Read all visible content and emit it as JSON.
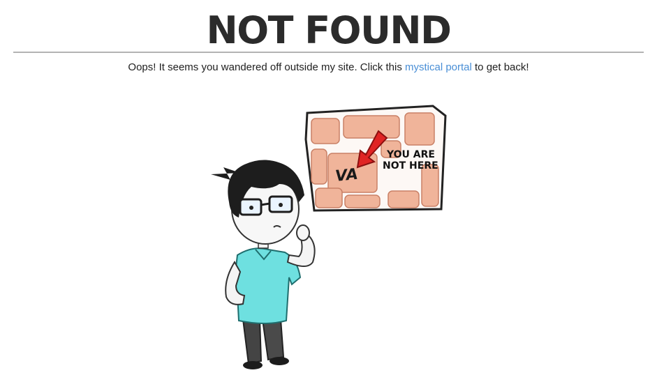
{
  "page": {
    "title": "NOT FOUND",
    "message": {
      "before": "Oops! It seems you wandered off outside my site. Click this ",
      "link_text": "mystical portal",
      "after": " to get back!"
    }
  },
  "illustration": {
    "map_text_line1": "YOU ARE",
    "map_text_line2": "NOT HERE",
    "map_logo": "VA"
  },
  "colors": {
    "link": "#4a8fd6",
    "shirt": "#6ee0e0",
    "map_tile": "#f0b49a",
    "arrow": "#e02424"
  }
}
